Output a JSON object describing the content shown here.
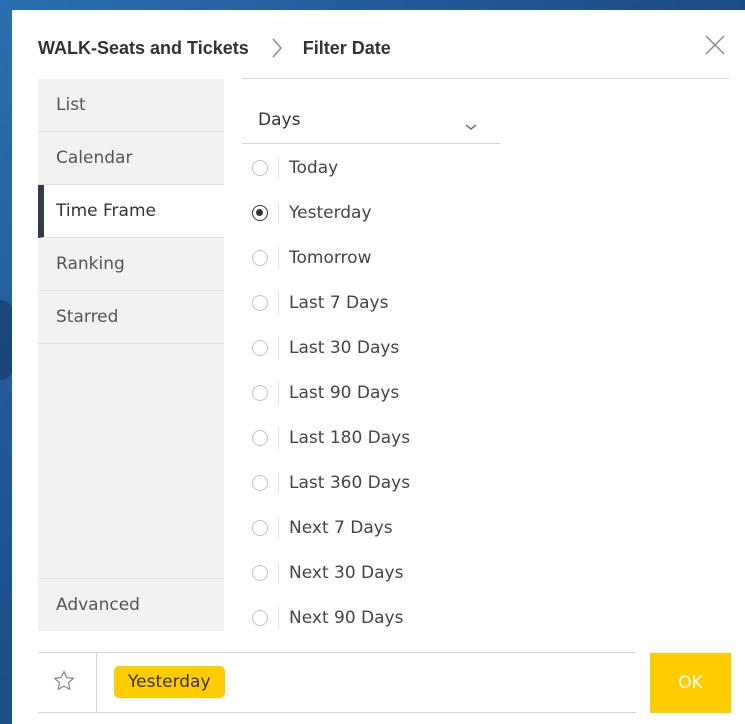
{
  "header": {
    "breadcrumb_root": "WALK-Seats and Tickets",
    "breadcrumb_current": "Filter Date"
  },
  "sidebar": {
    "items": [
      {
        "label": "List"
      },
      {
        "label": "Calendar"
      },
      {
        "label": "Time Frame",
        "active": true
      },
      {
        "label": "Ranking"
      },
      {
        "label": "Starred"
      }
    ],
    "advanced_label": "Advanced"
  },
  "unit_select": {
    "value": "Days"
  },
  "options": [
    {
      "label": "Today",
      "selected": false
    },
    {
      "label": "Yesterday",
      "selected": true
    },
    {
      "label": "Tomorrow",
      "selected": false
    },
    {
      "label": "Last 7 Days",
      "selected": false
    },
    {
      "label": "Last 30 Days",
      "selected": false
    },
    {
      "label": "Last 90 Days",
      "selected": false
    },
    {
      "label": "Last 180 Days",
      "selected": false
    },
    {
      "label": "Last 360 Days",
      "selected": false
    },
    {
      "label": "Next 7 Days",
      "selected": false
    },
    {
      "label": "Next 30 Days",
      "selected": false
    },
    {
      "label": "Next 90 Days",
      "selected": false
    }
  ],
  "footer": {
    "selected_chip": "Yesterday",
    "ok_label": "OK"
  },
  "colors": {
    "accent": "#ffcc00",
    "active_marker": "#333a48",
    "backdrop": "#1f4d86"
  },
  "icons": {
    "close": "close-icon",
    "breadcrumb_separator": "chevron-right-icon",
    "dropdown": "chevron-down-icon",
    "star": "star-outline-icon"
  }
}
